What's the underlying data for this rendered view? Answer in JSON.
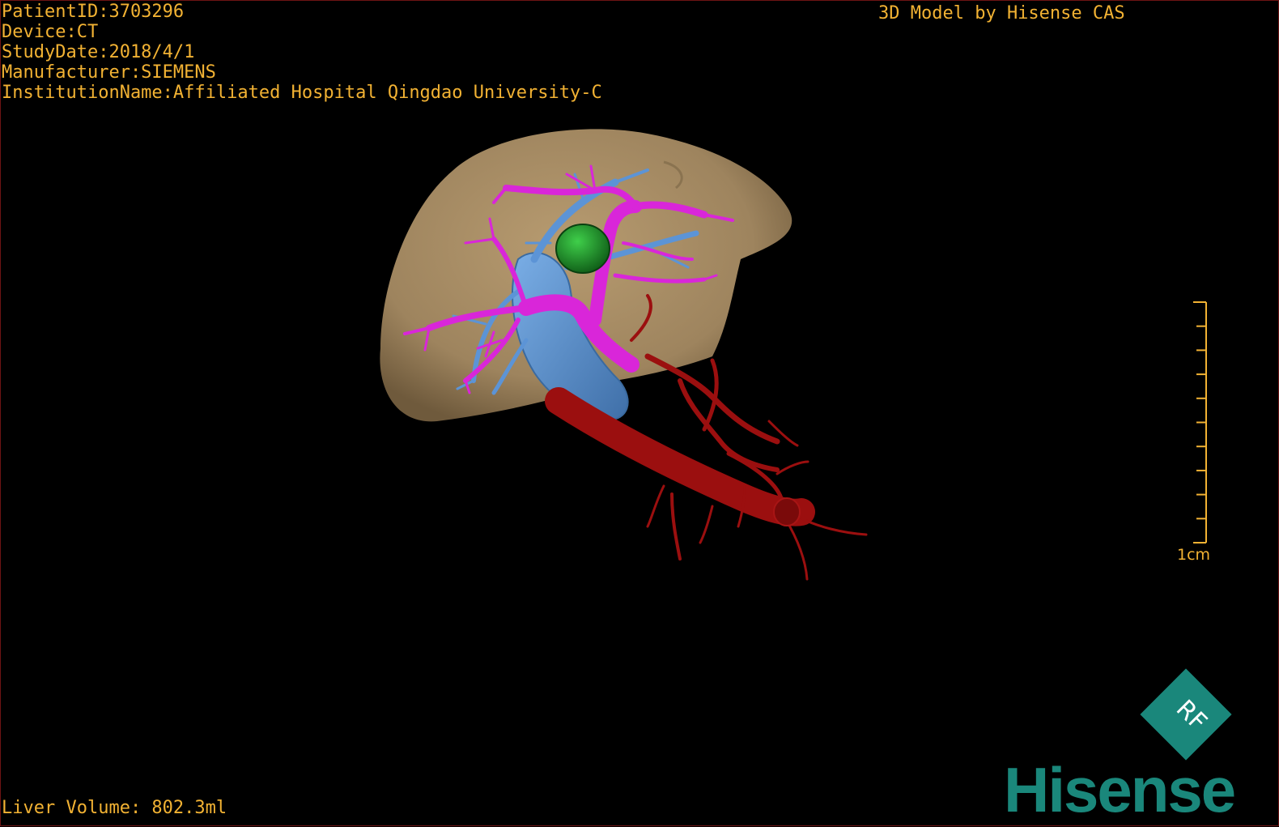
{
  "overlay": {
    "patient_id": "PatientID:3703296",
    "device": "Device:CT",
    "study_date": "StudyDate:2018/4/1",
    "manufacturer": "Manufacturer:SIEMENS",
    "institution": "InstitutionName:Affiliated Hospital Qingdao University-C",
    "brand_caption": "3D Model by Hisense CAS",
    "liver_volume": "Liver Volume: 802.3ml"
  },
  "scale_bar": {
    "label": "1cm",
    "tick_count": 10
  },
  "logo": {
    "badge_text": "RF",
    "wordmark": "Hisense"
  },
  "colors": {
    "text": "#f2b233",
    "liver": "#a38a64",
    "portal_vein": "#d926d9",
    "hepatic_vein": "#5c94d6",
    "artery": "#9b0f0f",
    "tumor": "#1f8a2a",
    "brand": "#1a877b"
  }
}
